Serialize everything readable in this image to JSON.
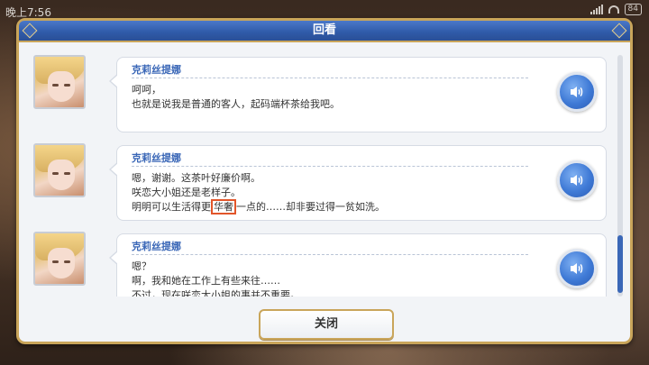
{
  "status_bar": {
    "time": "晚上7:56",
    "battery": "84"
  },
  "dialog": {
    "title": "回看",
    "close_label": "关闭",
    "entries": [
      {
        "speaker": "克莉丝提娜",
        "lines": [
          "呵呵，",
          "也就是说我是普通的客人，起码端杯茶给我吧。"
        ]
      },
      {
        "speaker": "克莉丝提娜",
        "lines": [
          "嗯，谢谢。这茶叶好廉价啊。",
          "咲恋大小姐还是老样子。"
        ],
        "line3_before": "明明可以生活得更",
        "line3_highlight": "华奢",
        "line3_after": "一点的……却非要过得一贫如洗。"
      },
      {
        "speaker": "克莉丝提娜",
        "lines": [
          "嗯？",
          "啊，我和她在工作上有些来往……",
          "不过，现在咲恋大小姐的事并不重要。"
        ]
      }
    ]
  },
  "icons": {
    "voice": "speaker-volume-icon"
  },
  "colors": {
    "title_bar": "#2f5aa8",
    "frame_gold": "#c9a55a",
    "speaker_name": "#3a67b7",
    "highlight_border": "#e2552a"
  }
}
